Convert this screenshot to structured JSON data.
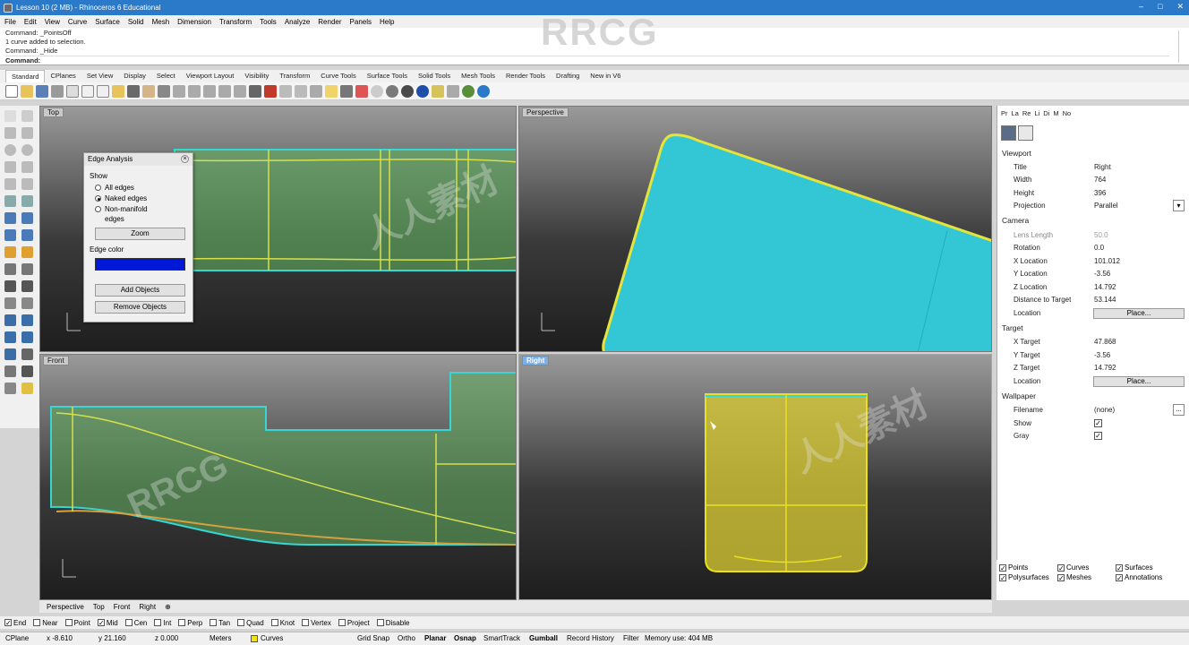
{
  "window": {
    "title": "Lesson 10 (2 MB) - Rhinoceros 6 Educational",
    "controls": [
      "–",
      "□",
      "✕"
    ]
  },
  "watermark": "RRCG",
  "watermark_secondary": "人人素材",
  "menu": [
    "File",
    "Edit",
    "View",
    "Curve",
    "Surface",
    "Solid",
    "Mesh",
    "Dimension",
    "Transform",
    "Tools",
    "Analyze",
    "Render",
    "Panels",
    "Help"
  ],
  "command_history": [
    "Command: _PointsOff",
    "1 curve added to selection.",
    "Command: _Hide"
  ],
  "command_prompt": "Command:",
  "toolbar_tabs": [
    "Standard",
    "CPlanes",
    "Set View",
    "Display",
    "Select",
    "Viewport Layout",
    "Visibility",
    "Transform",
    "Curve Tools",
    "Surface Tools",
    "Solid Tools",
    "Mesh Tools",
    "Render Tools",
    "Drafting",
    "New in V6"
  ],
  "viewports": {
    "top": "Top",
    "perspective": "Perspective",
    "front": "Front",
    "right": "Right"
  },
  "edge_analysis": {
    "title": "Edge Analysis",
    "show_label": "Show",
    "options": [
      "All edges",
      "Naked edges",
      "Non-manifold",
      "edges"
    ],
    "selected": "Naked edges",
    "zoom": "Zoom",
    "edge_color_label": "Edge color",
    "edge_color": "#0018d8",
    "add_objects": "Add Objects",
    "remove_objects": "Remove Objects"
  },
  "bottom_tabs": [
    "Perspective",
    "Top",
    "Front",
    "Right"
  ],
  "osnaps": [
    {
      "label": "End",
      "checked": true
    },
    {
      "label": "Near",
      "checked": false
    },
    {
      "label": "Point",
      "checked": false
    },
    {
      "label": "Mid",
      "checked": true
    },
    {
      "label": "Cen",
      "checked": false
    },
    {
      "label": "Int",
      "checked": false
    },
    {
      "label": "Perp",
      "checked": false
    },
    {
      "label": "Tan",
      "checked": false
    },
    {
      "label": "Quad",
      "checked": false
    },
    {
      "label": "Knot",
      "checked": false
    },
    {
      "label": "Vertex",
      "checked": false
    },
    {
      "label": "Project",
      "checked": false
    },
    {
      "label": "Disable",
      "checked": false
    }
  ],
  "status": {
    "cplane": "CPlane",
    "x": "x -8.610",
    "y": "y 21.160",
    "z": "z 0.000",
    "units": "Meters",
    "layer": "Curves",
    "layer_color": "#f2e600",
    "grid_snap": "Grid Snap",
    "ortho": "Ortho",
    "planar": "Planar",
    "osnap": "Osnap",
    "smarttrack": "SmartTrack",
    "gumball": "Gumball",
    "record_history": "Record History",
    "filter": "Filter",
    "memory": "Memory use: 404 MB"
  },
  "properties": {
    "tabs": [
      "Pr",
      "La",
      "Re",
      "Li",
      "Di",
      "M",
      "No"
    ],
    "viewport_section": "Viewport",
    "title_label": "Title",
    "title_value": "Right",
    "width_label": "Width",
    "width_value": "764",
    "height_label": "Height",
    "height_value": "396",
    "projection_label": "Projection",
    "projection_value": "Parallel",
    "camera_section": "Camera",
    "lens_label": "Lens Length",
    "lens_value": "50.0",
    "rotation_label": "Rotation",
    "rotation_value": "0.0",
    "xloc_label": "X Location",
    "xloc_value": "101.012",
    "yloc_label": "Y Location",
    "yloc_value": "-3.56",
    "zloc_label": "Z Location",
    "zloc_value": "14.792",
    "dist_label": "Distance to Target",
    "dist_value": "53.144",
    "location_label": "Location",
    "place_button": "Place...",
    "target_section": "Target",
    "xt_label": "X Target",
    "xt_value": "47.868",
    "yt_label": "Y Target",
    "yt_value": "-3.56",
    "zt_label": "Z Target",
    "zt_value": "14.792",
    "tloc_label": "Location",
    "tplace_button": "Place...",
    "wallpaper_section": "Wallpaper",
    "filename_label": "Filename",
    "filename_value": "(none)",
    "show_label": "Show",
    "gray_label": "Gray",
    "browse_button": "..."
  },
  "selection_filter": [
    {
      "label": "Points",
      "checked": true
    },
    {
      "label": "Curves",
      "checked": true
    },
    {
      "label": "Surfaces",
      "checked": true
    },
    {
      "label": "Polysurfaces",
      "checked": true
    },
    {
      "label": "Meshes",
      "checked": true
    },
    {
      "label": "Annotations",
      "checked": true
    }
  ]
}
